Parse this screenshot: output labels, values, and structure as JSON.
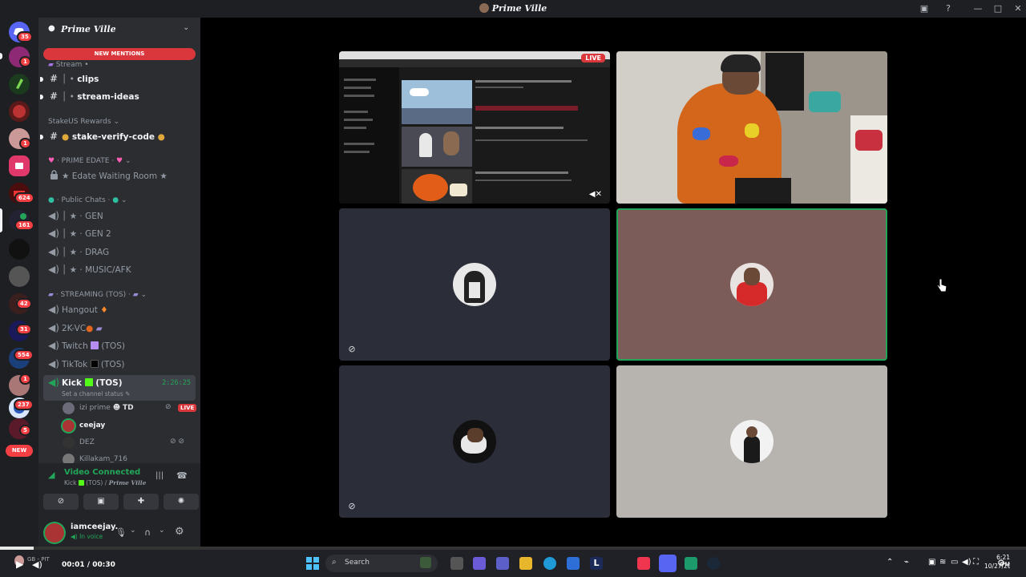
{
  "window": {
    "title": "Prime Ville"
  },
  "rail": {
    "badges": [
      "35",
      "1",
      "1",
      "624",
      "161",
      "42",
      "31",
      "554",
      "1",
      "237",
      "5"
    ],
    "new_label": "NEW"
  },
  "sidebar": {
    "server_name": "Prime Ville",
    "new_mentions": "NEW MENTIONS",
    "items": [
      {
        "type": "cat",
        "label": "Stream •"
      },
      {
        "type": "text",
        "label": "clips"
      },
      {
        "type": "text",
        "label": "stream-ideas"
      },
      {
        "type": "cat",
        "label": "StakeUS Rewards"
      },
      {
        "type": "text",
        "label": "stake-verify-code"
      },
      {
        "type": "cat",
        "label": "PRIME EDATE"
      },
      {
        "type": "locked",
        "label": "★ Edate Waiting Room ★"
      },
      {
        "type": "cat",
        "label": "Public Chats"
      },
      {
        "type": "voice",
        "label": "GEN"
      },
      {
        "type": "voice",
        "label": "GEN 2"
      },
      {
        "type": "voice",
        "label": "DRAG"
      },
      {
        "type": "voice",
        "label": "MUSIC/AFK"
      },
      {
        "type": "cat",
        "label": "STREAMING (TOS)"
      },
      {
        "type": "voice",
        "label": "Hangout"
      },
      {
        "type": "voice",
        "label": "2K-VC"
      },
      {
        "type": "voice",
        "label": "Twitch"
      },
      {
        "type": "voice",
        "label": "TikTok"
      }
    ],
    "active_channel": {
      "name": "Kick",
      "suffix": "(TOS)",
      "timer": "2:26:25",
      "status": "Set a channel status"
    },
    "voice_users": [
      {
        "name": "izi prime",
        "tag": "TD",
        "live": "LIVE"
      },
      {
        "name": "ceejay"
      },
      {
        "name": "DEZ"
      },
      {
        "name": "Killakam_716"
      }
    ]
  },
  "voice_panel": {
    "status": "Video Connected",
    "sub_channel": "Kick",
    "sub_suffix": "(TOS) /",
    "sub_server": "Prime Ville"
  },
  "user_panel": {
    "username": "iamceejay.",
    "status": "In voice"
  },
  "stage": {
    "live_label": "LIVE"
  },
  "player": {
    "time": "00:01 / 00:30",
    "progress": 0.033,
    "media_label": "GB - PIT"
  },
  "taskbar": {
    "search_placeholder": "Search",
    "clock_time": "6:21 PM",
    "clock_date": "10/27/2025"
  },
  "colors": {
    "accent_green": "#23a559",
    "mention_red": "#da373c",
    "rail_bg": "#1e1f22",
    "sidebar_bg": "#2b2d31",
    "tile_dark": "#2b2d38",
    "tile_mauve": "#7b5c59",
    "tile_gray": "#b7b4b0"
  }
}
